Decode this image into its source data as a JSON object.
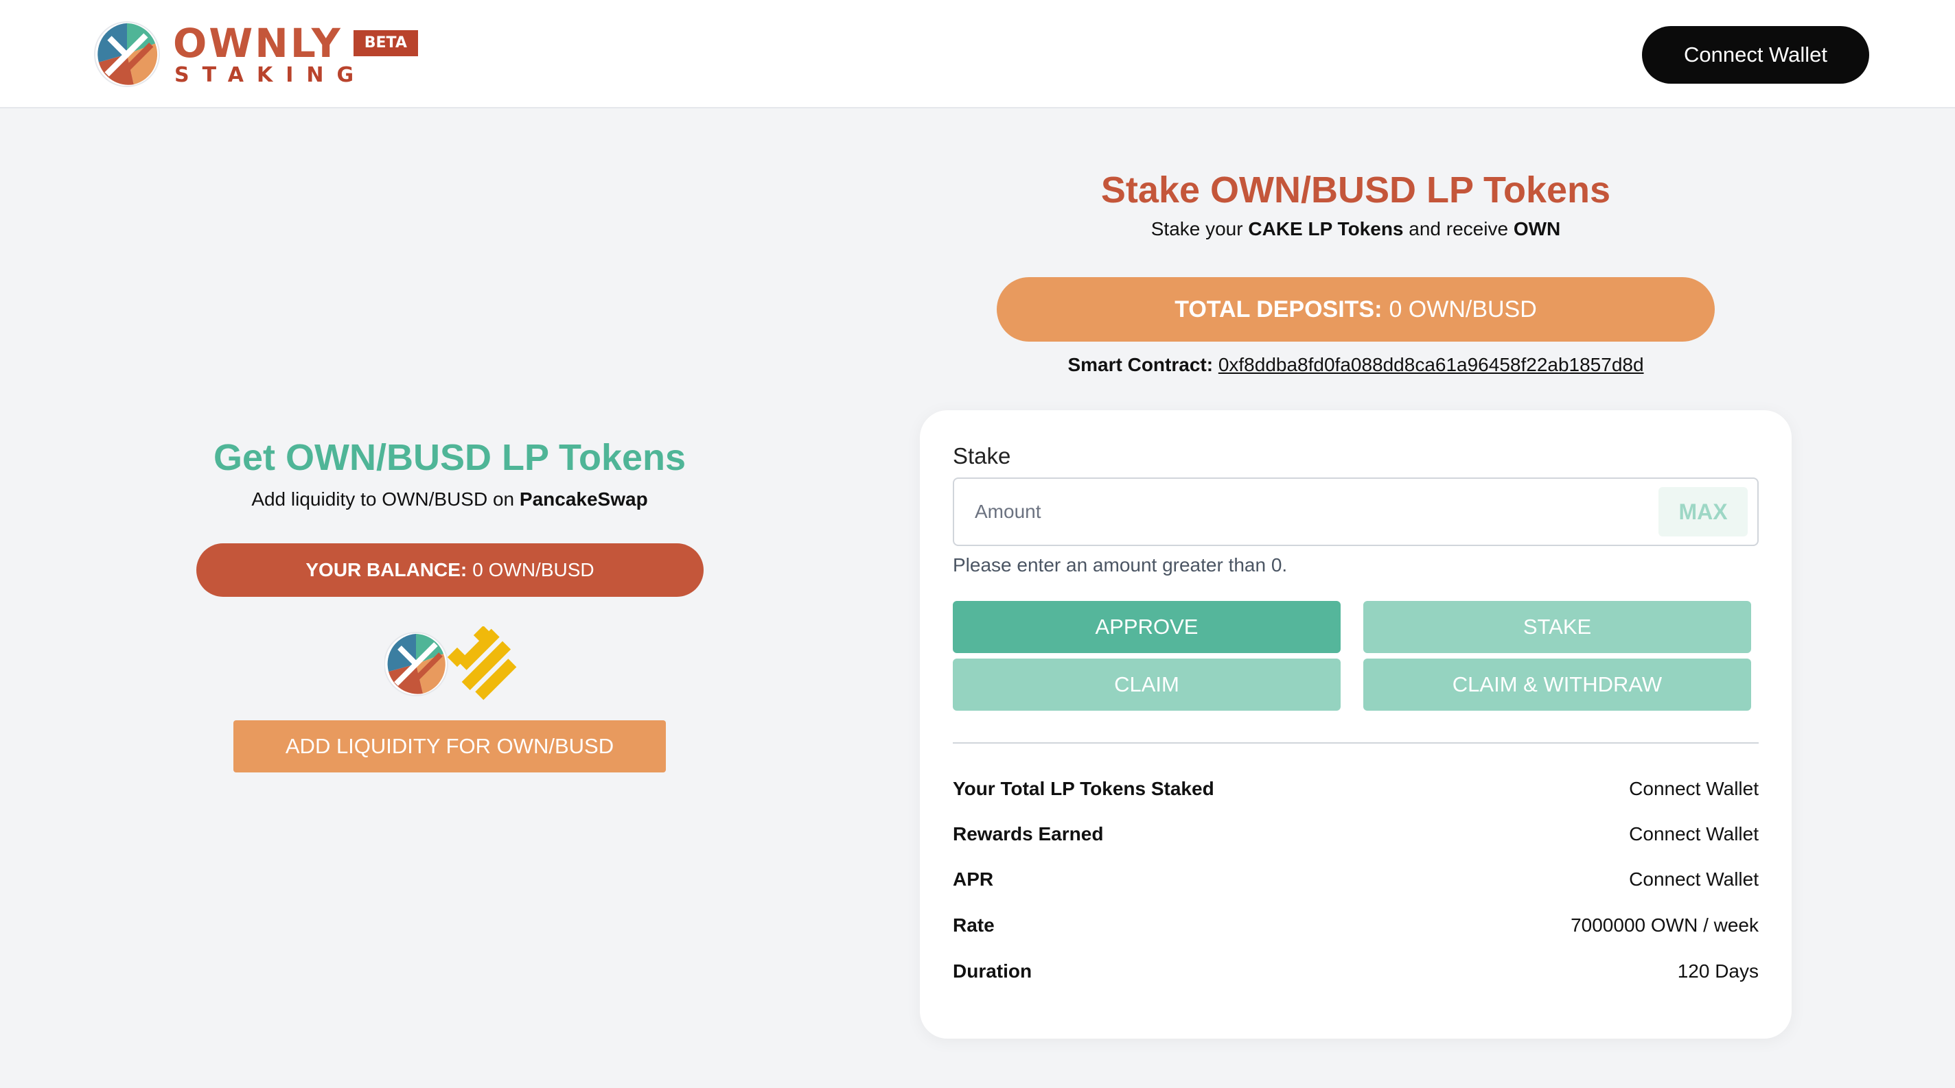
{
  "header": {
    "logo_word": "OWNLY",
    "logo_badge": "BETA",
    "logo_sub": "STAKING",
    "connect_label": "Connect Wallet"
  },
  "left": {
    "title": "Get OWN/BUSD LP Tokens",
    "subtitle_prefix": "Add liquidity to OWN/BUSD on ",
    "subtitle_link": "PancakeSwap",
    "balance_label": "YOUR BALANCE:",
    "balance_value": "0 OWN/BUSD",
    "add_liquidity_label": "ADD LIQUIDITY FOR OWN/BUSD",
    "icons": [
      "ownly-token-icon",
      "busd-token-icon"
    ]
  },
  "right": {
    "title": "Stake OWN/BUSD LP Tokens",
    "subtitle_1": "Stake your ",
    "subtitle_bold_1": "CAKE LP Tokens",
    "subtitle_2": " and receive ",
    "subtitle_bold_2": "OWN",
    "deposits_label": "TOTAL DEPOSITS:",
    "deposits_value": "0 OWN/BUSD",
    "contract_label": "Smart Contract:",
    "contract_address": "0xf8ddba8fd0fa088dd8ca61a96458f22ab1857d8d"
  },
  "card": {
    "stake_label": "Stake",
    "amount_placeholder": "Amount",
    "amount_value": "",
    "max_label": "MAX",
    "hint": "Please enter an amount greater than 0.",
    "approve_label": "APPROVE",
    "stake_btn_label": "STAKE",
    "claim_label": "CLAIM",
    "claim_withdraw_label": "CLAIM & WITHDRAW",
    "stats": [
      {
        "label": "Your Total LP Tokens Staked",
        "value": "Connect Wallet"
      },
      {
        "label": "Rewards Earned",
        "value": "Connect Wallet"
      },
      {
        "label": "APR",
        "value": "Connect Wallet"
      },
      {
        "label": "Rate",
        "value": "7000000 OWN / week"
      },
      {
        "label": "Duration",
        "value": "120 Days"
      }
    ]
  },
  "colors": {
    "brand_red": "#c4563a",
    "brand_orange": "#e89a5e",
    "brand_green": "#55b69b",
    "brand_green_light": "#95d3c0",
    "busd_yellow": "#f0b90b"
  }
}
